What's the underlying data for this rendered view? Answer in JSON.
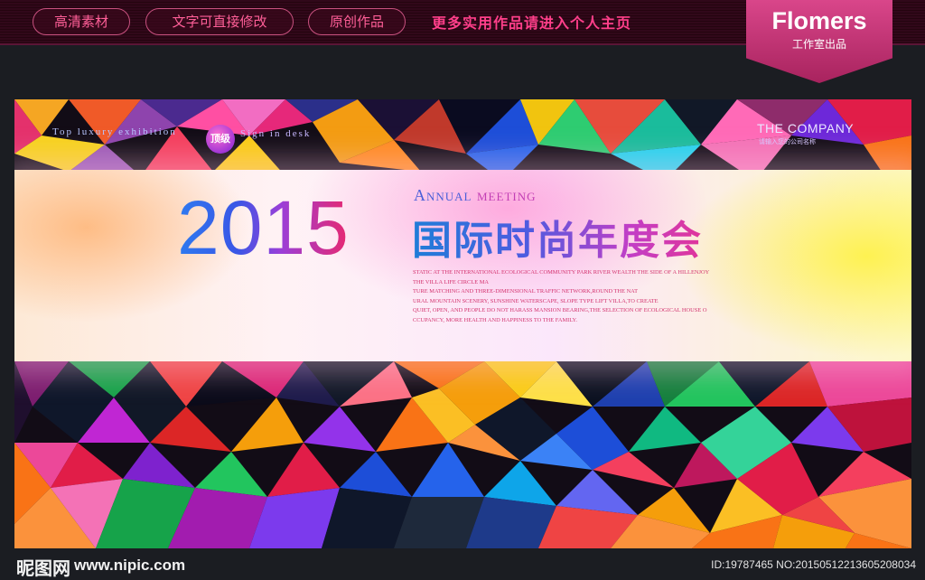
{
  "top_bar": {
    "pills": [
      "高清素材",
      "文字可直接修改",
      "原创作品"
    ],
    "more_link": "更多实用作品请进入个人主页"
  },
  "brand": {
    "name": "Flomers",
    "subtitle": "工作室出品"
  },
  "banner": {
    "tag_left": "Top luxury exhibition",
    "badge": "顶级",
    "tag_right": "Sign in desk",
    "company": "THE COMPANY",
    "company_sub": "请输入您的公司名称",
    "year": "2015",
    "annual": "Annual",
    "meeting": "meeting",
    "title": "国际时尚年度会",
    "description": [
      "STATIC AT THE INTERNATIONAL ECOLOGICAL COMMUNITY PARK RIVER WEALTH THE SIDE OF A HILLENJOY",
      "THE VILLA LIFE CIRCLE MA",
      "TURE MATCHING AND THREE-DIMENSIONAL TRAFFIC NETWORK,ROUND THE NAT",
      "URAL MOUNTAIN SCENERY, SUNSHINE WATERSCAPE, SLOPE TYPE LIFT VILLA,TO CREATE",
      "QUIET, OPEN, AND PEOPLE DO NOT HARASS MANSION BEARING,THE SELECTION OF ECOLOGICAL HOUSE O",
      "CCUPANCY, MORE HEALTH AND HAPPINESS TO THE FAMILY."
    ]
  },
  "watermark": {
    "site_name": "昵图网",
    "url": "www.nipic.com",
    "id_text": "ID:19787465 NO:20150512213605208034"
  },
  "colors": {
    "accent_pink": "#ff3f8a",
    "brand_magenta": "#c2336f",
    "year_blue": "#2e7bf0",
    "year_red": "#e8286f"
  }
}
